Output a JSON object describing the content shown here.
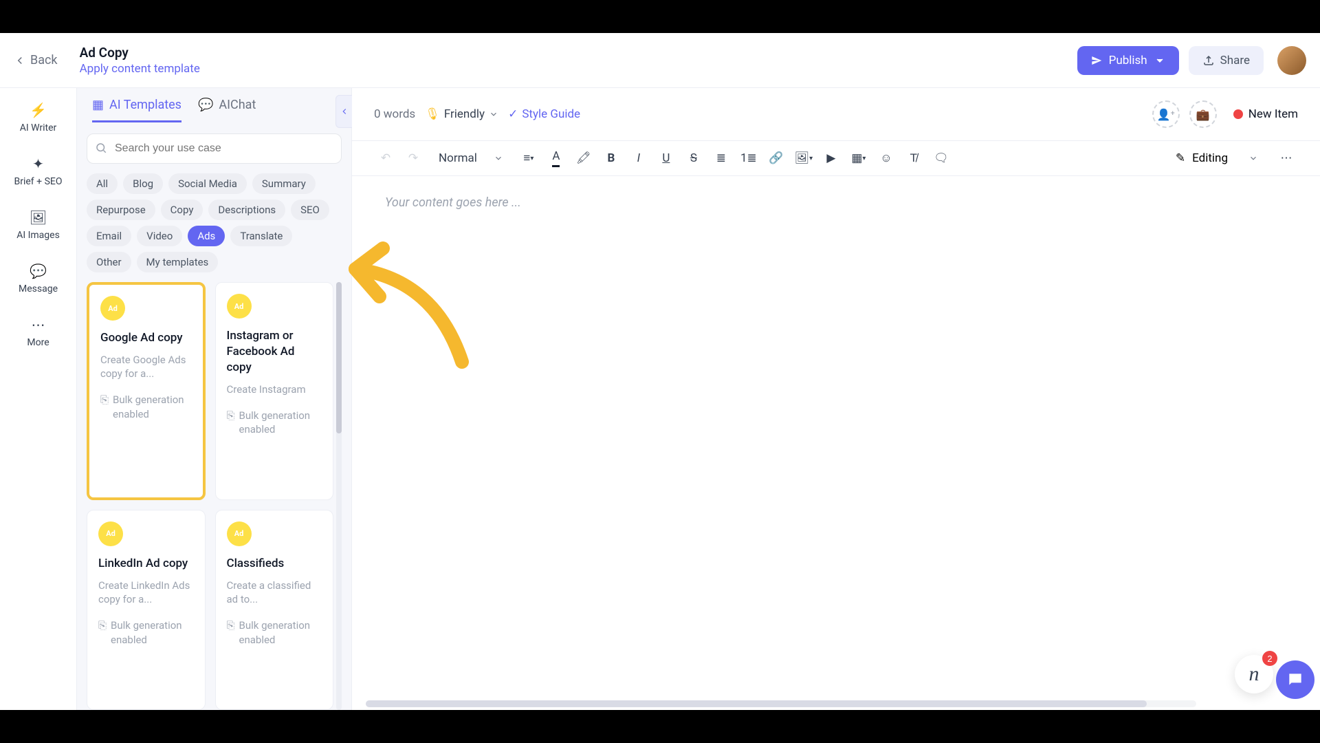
{
  "header": {
    "back": "Back",
    "title": "Ad Copy",
    "subtitle": "Apply content template",
    "publish": "Publish",
    "share": "Share"
  },
  "vnav": [
    {
      "icon": "⚡",
      "label": "AI Writer",
      "active": true
    },
    {
      "icon": "✦",
      "label": "Brief + SEO"
    },
    {
      "icon": "🖼",
      "label": "AI Images"
    },
    {
      "icon": "💬",
      "label": "Message"
    },
    {
      "icon": "⋯",
      "label": "More"
    }
  ],
  "panel": {
    "tabs": [
      {
        "icon": "⬚⬚",
        "label": "AI Templates",
        "active": true
      },
      {
        "icon": "💬",
        "label": "AIChat"
      }
    ],
    "search_placeholder": "Search your use case",
    "chips": [
      "All",
      "Blog",
      "Social Media",
      "Summary",
      "Repurpose",
      "Copy",
      "Descriptions",
      "SEO",
      "Email",
      "Video",
      "Ads",
      "Translate",
      "Other",
      "My templates"
    ],
    "chip_active": "Ads",
    "cards": [
      {
        "title": "Google Ad copy",
        "desc": "Create Google Ads copy for a...",
        "bulk": "Bulk generation enabled",
        "highlight": true
      },
      {
        "title": "Instagram or Facebook Ad copy",
        "desc": "Create Instagram",
        "bulk": "Bulk generation enabled"
      },
      {
        "title": "LinkedIn Ad copy",
        "desc": "Create LinkedIn Ads copy for a...",
        "bulk": "Bulk generation enabled"
      },
      {
        "title": "Classifieds",
        "desc": "Create a classified ad to...",
        "bulk": "Bulk generation enabled"
      }
    ]
  },
  "editor": {
    "word_count": "0 words",
    "tone": "Friendly",
    "style_guide": "Style Guide",
    "status": "New Item",
    "format_label": "Normal",
    "editing_label": "Editing",
    "placeholder": "Your content goes here ..."
  },
  "notifications": {
    "count": "2"
  },
  "colors": {
    "accent": "#6366f1",
    "highlight": "#f5c542",
    "status_dot": "#ef4444"
  }
}
